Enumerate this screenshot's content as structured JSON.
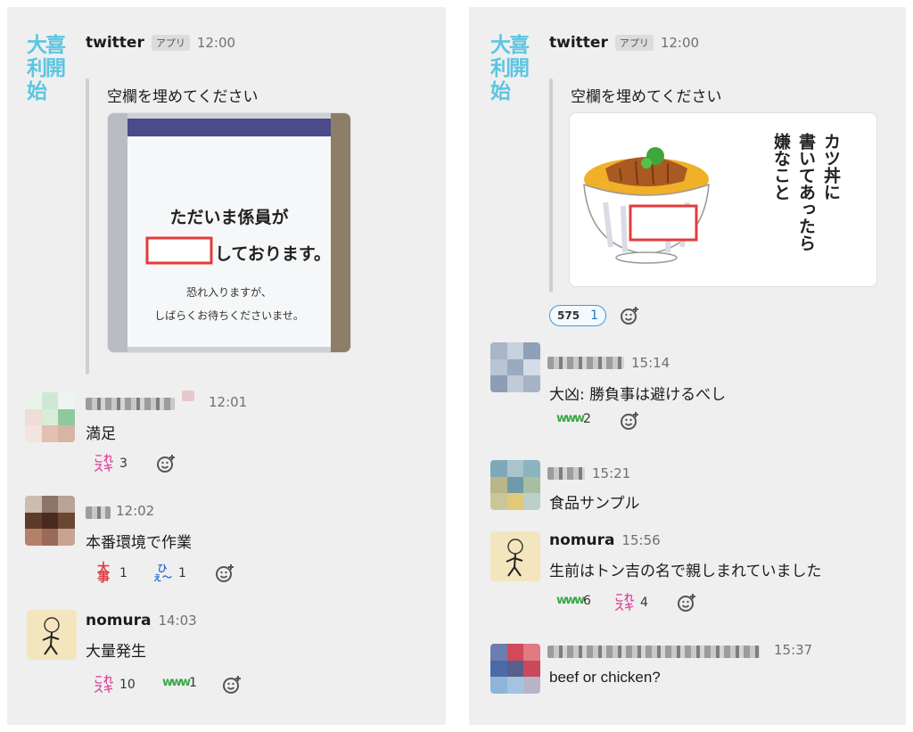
{
  "colors": {
    "panel_bg": "#efeff0",
    "logo": "#5bc6e1",
    "red_box": "#e33b3b",
    "reaction_border": "#3a9bd9"
  },
  "left": {
    "bot": {
      "logo": "大喜利開始",
      "name": "twitter",
      "tag": "アプリ",
      "time": "12:00",
      "prompt": "空欄を埋めてください"
    },
    "image": {
      "line1": "ただいま係員が",
      "line2": "しております。",
      "line3": "恐れ入りますが、",
      "line4": "しばらくお待ちくださいませ。"
    },
    "messages": [
      {
        "user": "",
        "time": "12:01",
        "text": "満足",
        "reactions": [
          {
            "emoji": "これスキ",
            "count": "3"
          }
        ]
      },
      {
        "user": "",
        "time": "12:02",
        "text": "本番環境で作業",
        "reactions": [
          {
            "emoji": "大事",
            "count": "1"
          },
          {
            "emoji": "ひぇ〜",
            "count": "1"
          }
        ]
      },
      {
        "user": "nomura",
        "time": "14:03",
        "text": "大量発生",
        "reactions": [
          {
            "emoji": "これスキ",
            "count": "10"
          },
          {
            "emoji": "www",
            "count": "1"
          }
        ]
      }
    ]
  },
  "right": {
    "bot": {
      "logo": "大喜利開始",
      "name": "twitter",
      "tag": "アプリ",
      "time": "12:00",
      "prompt": "空欄を埋めてください"
    },
    "image": {
      "col1": "カツ丼に",
      "col2": "書いてあったら",
      "col3": "嫌なこと"
    },
    "bot_reactions": [
      {
        "emoji": "575",
        "count": "1"
      }
    ],
    "messages": [
      {
        "user": "",
        "time": "15:14",
        "text": "大凶: 勝負事は避けるべし",
        "reactions": [
          {
            "emoji": "www",
            "count": "2"
          }
        ]
      },
      {
        "user": "",
        "time": "15:21",
        "text": "食品サンプル",
        "reactions": []
      },
      {
        "user": "nomura",
        "time": "15:56",
        "text": "生前はトン吉の名で親しまれていました",
        "reactions": [
          {
            "emoji": "www",
            "count": "6"
          },
          {
            "emoji": "これスキ",
            "count": "4"
          }
        ]
      },
      {
        "user": "",
        "time": "15:37",
        "text": "beef or chicken?",
        "reactions": []
      }
    ]
  },
  "icons": {
    "add_reaction": "add-reaction-icon"
  }
}
